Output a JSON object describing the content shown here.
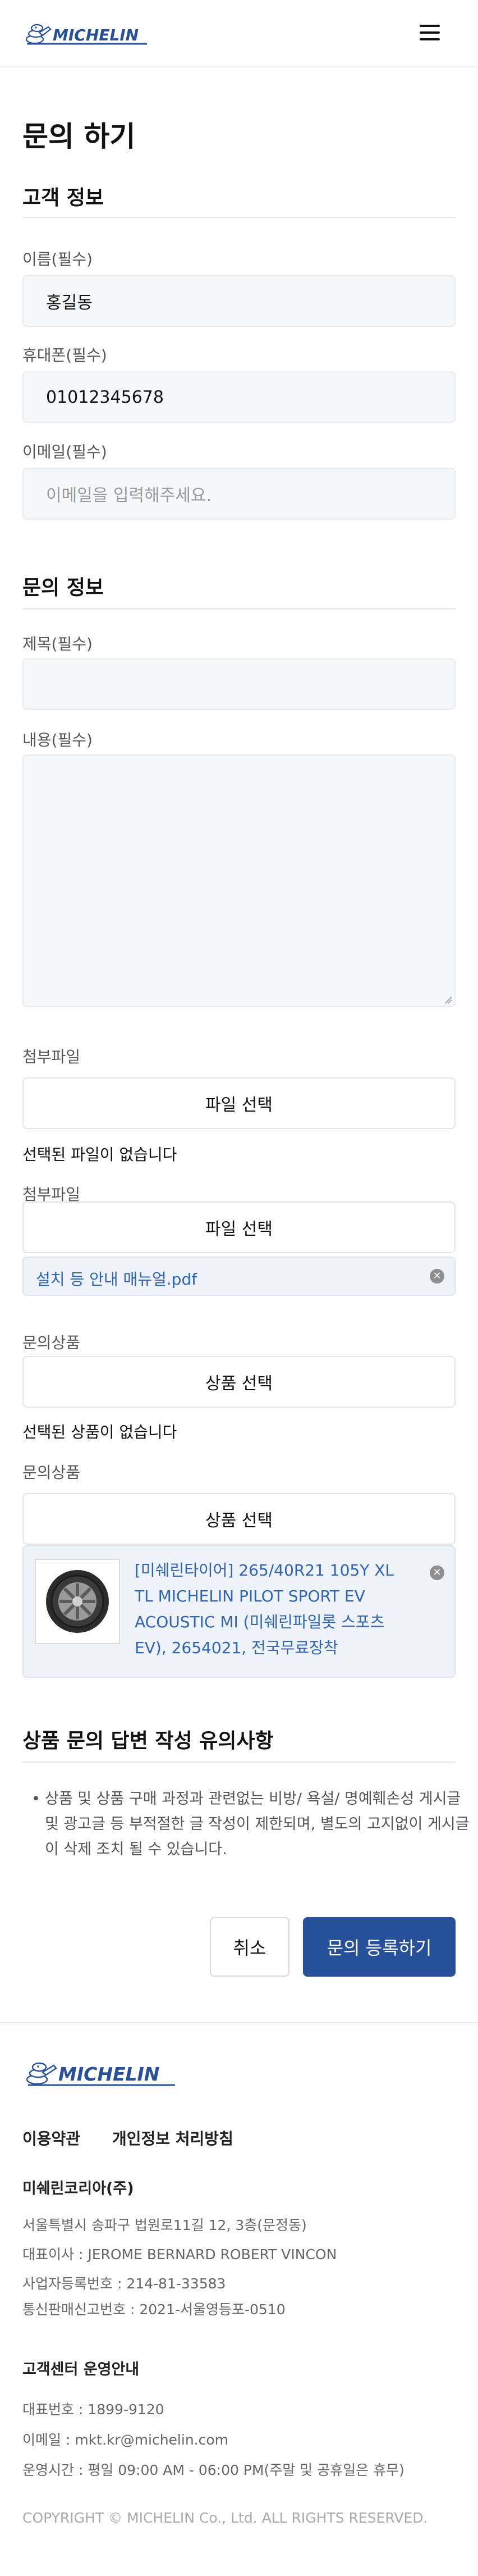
{
  "header": {
    "logo_text": "MICHELIN",
    "menu_icon": "hamburger-menu-icon"
  },
  "page_title": "문의 하기",
  "customer_section": {
    "title": "고객 정보",
    "name_label": "이름(필수)",
    "name_value": "홍길동",
    "phone_label": "휴대폰(필수)",
    "phone_value": "01012345678",
    "email_label": "이메일(필수)",
    "email_placeholder": "이메일을 입력해주세요."
  },
  "inquiry_section": {
    "title": "문의 정보",
    "subject_label": "제목(필수)",
    "subject_value": "",
    "content_label": "내용(필수)",
    "content_value": ""
  },
  "attachments": [
    {
      "label": "첨부파일",
      "button": "파일 선택",
      "status": "선택된 파일이 없습니다"
    },
    {
      "label": "첨부파일",
      "button": "파일 선택",
      "file_name": "설치 등 안내 매뉴얼.pdf"
    }
  ],
  "products": [
    {
      "label": "문의상품",
      "button": "상품 선택",
      "status": "선택된 상품이 없습니다"
    },
    {
      "label": "문의상품",
      "button": "상품 선택",
      "product_name": "[미쉐린타이어] 265/40R21 105Y XL TL MICHELIN PILOT SPORT EV ACOUSTIC MI (미쉐린파일롯 스포츠 EV), 2654021, 전국무료장착"
    }
  ],
  "notice": {
    "title": "상품 문의 답변 작성 유의사항",
    "text": "상품 및 상품 구매 과정과 관련없는 비방/ 욕설/ 명예훼손성 게시글 및 광고글 등 부적절한 글 작성이 제한되며, 별도의 고지없이 게시글이 삭제 조치 될 수 있습니다."
  },
  "actions": {
    "cancel": "취소",
    "submit": "문의 등록하기"
  },
  "footer": {
    "logo_text": "MICHELIN",
    "links": [
      "이용약관",
      "개인정보 처리방침"
    ],
    "company": {
      "name": "미쉐린코리아(주)",
      "address": "서울특별시 송파구 법원로11길 12, 3층(문정동)",
      "ceo": "대표이사 : JEROME BERNARD ROBERT VINCON",
      "biz_no": "사업자등록번호 : 214-81-33583",
      "mail_order_no": "통신판매신고번호 : 2021-서울영등포-0510"
    },
    "cs": {
      "title": "고객센터 운영안내",
      "phone": "대표번호 : 1899-9120",
      "email": "이메일 : mkt.kr@michelin.com",
      "hours": "운영시간 : 평일 09:00 AM - 06:00 PM(주말 및 공휴일은 휴무)"
    },
    "copyright": "COPYRIGHT © MICHELIN Co., Ltd. ALL RIGHTS RESERVED."
  },
  "colors": {
    "brand_blue": "#27509b",
    "link_blue": "#2f63b5",
    "field_bg": "#f5f7f8"
  }
}
